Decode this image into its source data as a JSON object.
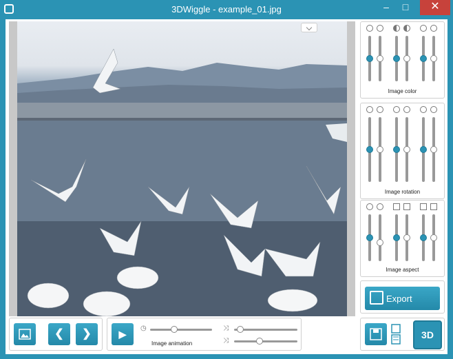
{
  "window": {
    "title": "3DWiggle - example_01.jpg",
    "min_glyph": "–",
    "max_glyph": "□",
    "close_glyph": "✕"
  },
  "panels": {
    "image_color": {
      "label": "Image color",
      "levels": [
        0.5,
        0.5,
        0.5,
        0.5,
        0.5,
        0.5
      ]
    },
    "image_rotation": {
      "label": "Image rotation",
      "levels": [
        0.5,
        0.5,
        0.5,
        0.5,
        0.5,
        0.5
      ]
    },
    "image_aspect": {
      "label": "Image aspect",
      "levels": [
        0.5,
        0.3,
        0.5,
        0.5,
        0.5,
        0.5
      ]
    }
  },
  "export": {
    "label": "Export"
  },
  "toolbar": {
    "prev_glyph": "❮",
    "next_glyph": "❯",
    "play_glyph": "▶",
    "animation_label": "Image animation",
    "speed_level": 0.32,
    "effect_level_1": 0.04,
    "effect_level_2": 0.35
  },
  "logo": {
    "text": "3D"
  },
  "colors": {
    "accent": "#2b93b4",
    "close": "#c7423b"
  },
  "icons": [
    "app-icon",
    "image-open-icon",
    "chevron-left-icon",
    "chevron-right-icon",
    "play-icon",
    "clock-icon",
    "shuffle-icon",
    "save-icon",
    "film-icon",
    "export-icon",
    "brightness-icon",
    "contrast-icon",
    "rotate-icon"
  ]
}
